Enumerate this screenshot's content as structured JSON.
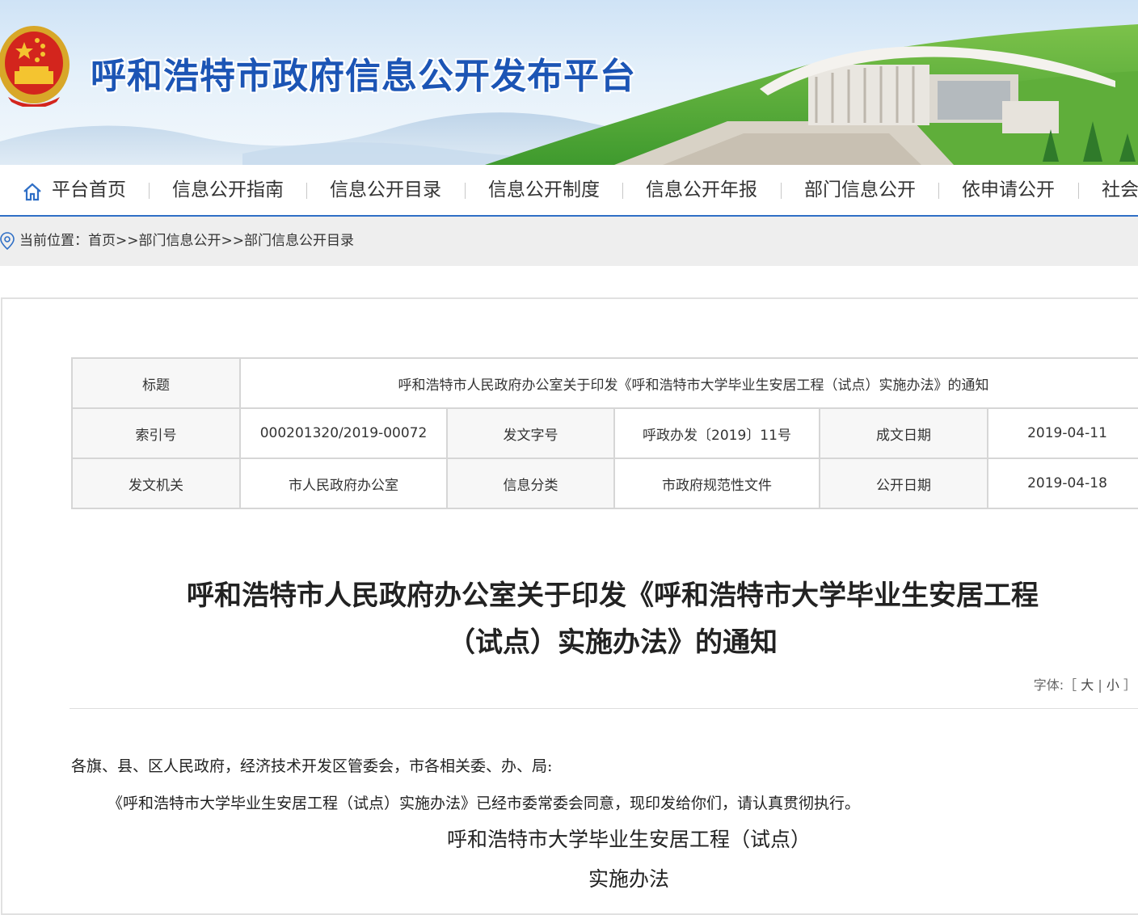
{
  "site": {
    "title": "呼和浩特市政府信息公开发布平台"
  },
  "nav": {
    "items": [
      {
        "label": "平台首页"
      },
      {
        "label": "信息公开指南"
      },
      {
        "label": "信息公开目录"
      },
      {
        "label": "信息公开制度"
      },
      {
        "label": "信息公开年报"
      },
      {
        "label": "部门信息公开"
      },
      {
        "label": "依申请公开"
      },
      {
        "label": "社会"
      }
    ],
    "accent": "#2f6fc6"
  },
  "breadcrumb": {
    "text": "当前位置：首页>>部门信息公开>>部门信息公开目录"
  },
  "meta": {
    "title_label": "标题",
    "title_value": "呼和浩特市人民政府办公室关于印发《呼和浩特市大学毕业生安居工程（试点）实施办法》的通知",
    "index_label": "索引号",
    "index_value": "000201320/2019-00072",
    "docno_label": "发文字号",
    "docno_value": "呼政办发〔2019〕11号",
    "created_label": "成文日期",
    "created_value": "2019-04-11",
    "issuer_label": "发文机关",
    "issuer_value": "市人民政府办公室",
    "category_label": "信息分类",
    "category_value": "市政府规范性文件",
    "published_label": "公开日期",
    "published_value": "2019-04-18"
  },
  "document": {
    "title_line1": "呼和浩特市人民政府办公室关于印发《呼和浩特市大学毕业生安居工程",
    "title_line2": "（试点）实施办法》的通知",
    "font_control": {
      "label": "字体:［",
      "large": "大",
      "sep": "|",
      "small": "小",
      "close": "］"
    },
    "salutation": "各旗、县、区人民政府，经济技术开发区管委会，市各相关委、办、局:",
    "paragraph1": "《呼和浩特市大学毕业生安居工程（试点）实施办法》已经市委常委会同意，现印发给你们，请认真贯彻执行。",
    "attachment_title": "呼和浩特市大学毕业生安居工程（试点）",
    "attachment_subtitle": "实施办法"
  }
}
